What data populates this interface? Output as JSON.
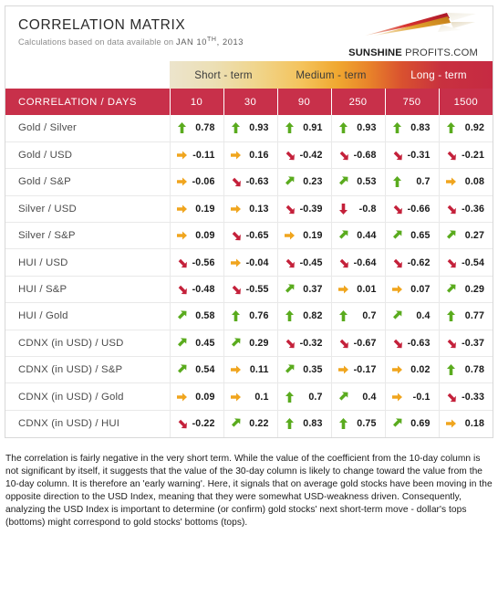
{
  "header": {
    "title": "CORRELATION MATRIX",
    "subtitle_prefix": "Calculations based on data available on",
    "date_day": "JAN 10",
    "date_ordinal": "TH",
    "date_year": ", 2013",
    "logo_bold": "SUNSHINE",
    "logo_rest": " PROFITS.COM"
  },
  "band": {
    "segments": [
      {
        "label": "Short - term",
        "span": 2
      },
      {
        "label": "Medium - term",
        "span": 2
      },
      {
        "label": "Long - term",
        "span": 2
      }
    ]
  },
  "table": {
    "corner_header": "CORRELATION / DAYS",
    "columns": [
      "10",
      "30",
      "90",
      "250",
      "750",
      "1500"
    ],
    "rows": [
      {
        "label": "Gold / Silver",
        "cells": [
          {
            "v": "0.78",
            "a": "arrow-up-green"
          },
          {
            "v": "0.93",
            "a": "arrow-up-green"
          },
          {
            "v": "0.91",
            "a": "arrow-up-green"
          },
          {
            "v": "0.93",
            "a": "arrow-up-green"
          },
          {
            "v": "0.83",
            "a": "arrow-up-green"
          },
          {
            "v": "0.92",
            "a": "arrow-up-green"
          }
        ]
      },
      {
        "label": "Gold / USD",
        "cells": [
          {
            "v": "-0.11",
            "a": "arrow-right-orange"
          },
          {
            "v": "0.16",
            "a": "arrow-right-orange"
          },
          {
            "v": "-0.42",
            "a": "arrow-downright-red"
          },
          {
            "v": "-0.68",
            "a": "arrow-downright-red"
          },
          {
            "v": "-0.31",
            "a": "arrow-downright-red"
          },
          {
            "v": "-0.21",
            "a": "arrow-downright-red"
          }
        ]
      },
      {
        "label": "Gold / S&P",
        "cells": [
          {
            "v": "-0.06",
            "a": "arrow-right-orange"
          },
          {
            "v": "-0.63",
            "a": "arrow-downright-red"
          },
          {
            "v": "0.23",
            "a": "arrow-upright-green"
          },
          {
            "v": "0.53",
            "a": "arrow-upright-green"
          },
          {
            "v": "0.7",
            "a": "arrow-up-green"
          },
          {
            "v": "0.08",
            "a": "arrow-right-orange"
          }
        ]
      },
      {
        "label": "Silver / USD",
        "cells": [
          {
            "v": "0.19",
            "a": "arrow-right-orange"
          },
          {
            "v": "0.13",
            "a": "arrow-right-orange"
          },
          {
            "v": "-0.39",
            "a": "arrow-downright-red"
          },
          {
            "v": "-0.8",
            "a": "arrow-down-red"
          },
          {
            "v": "-0.66",
            "a": "arrow-downright-red"
          },
          {
            "v": "-0.36",
            "a": "arrow-downright-red"
          }
        ]
      },
      {
        "label": "Silver / S&P",
        "cells": [
          {
            "v": "0.09",
            "a": "arrow-right-orange"
          },
          {
            "v": "-0.65",
            "a": "arrow-downright-red"
          },
          {
            "v": "0.19",
            "a": "arrow-right-orange"
          },
          {
            "v": "0.44",
            "a": "arrow-upright-green"
          },
          {
            "v": "0.65",
            "a": "arrow-upright-green"
          },
          {
            "v": "0.27",
            "a": "arrow-upright-green"
          }
        ]
      },
      {
        "label": "HUI / USD",
        "cells": [
          {
            "v": "-0.56",
            "a": "arrow-downright-red"
          },
          {
            "v": "-0.04",
            "a": "arrow-right-orange"
          },
          {
            "v": "-0.45",
            "a": "arrow-downright-red"
          },
          {
            "v": "-0.64",
            "a": "arrow-downright-red"
          },
          {
            "v": "-0.62",
            "a": "arrow-downright-red"
          },
          {
            "v": "-0.54",
            "a": "arrow-downright-red"
          }
        ]
      },
      {
        "label": "HUI / S&P",
        "cells": [
          {
            "v": "-0.48",
            "a": "arrow-downright-red"
          },
          {
            "v": "-0.55",
            "a": "arrow-downright-red"
          },
          {
            "v": "0.37",
            "a": "arrow-upright-green"
          },
          {
            "v": "0.01",
            "a": "arrow-right-orange"
          },
          {
            "v": "0.07",
            "a": "arrow-right-orange"
          },
          {
            "v": "0.29",
            "a": "arrow-upright-green"
          }
        ]
      },
      {
        "label": "HUI / Gold",
        "cells": [
          {
            "v": "0.58",
            "a": "arrow-upright-green"
          },
          {
            "v": "0.76",
            "a": "arrow-up-green"
          },
          {
            "v": "0.82",
            "a": "arrow-up-green"
          },
          {
            "v": "0.7",
            "a": "arrow-up-green"
          },
          {
            "v": "0.4",
            "a": "arrow-upright-green"
          },
          {
            "v": "0.77",
            "a": "arrow-up-green"
          }
        ]
      },
      {
        "label": "CDNX (in USD) / USD",
        "cells": [
          {
            "v": "0.45",
            "a": "arrow-upright-green"
          },
          {
            "v": "0.29",
            "a": "arrow-upright-green"
          },
          {
            "v": "-0.32",
            "a": "arrow-downright-red"
          },
          {
            "v": "-0.67",
            "a": "arrow-downright-red"
          },
          {
            "v": "-0.63",
            "a": "arrow-downright-red"
          },
          {
            "v": "-0.37",
            "a": "arrow-downright-red"
          }
        ]
      },
      {
        "label": "CDNX (in USD) / S&P",
        "cells": [
          {
            "v": "0.54",
            "a": "arrow-upright-green"
          },
          {
            "v": "0.11",
            "a": "arrow-right-orange"
          },
          {
            "v": "0.35",
            "a": "arrow-upright-green"
          },
          {
            "v": "-0.17",
            "a": "arrow-right-orange"
          },
          {
            "v": "0.02",
            "a": "arrow-right-orange"
          },
          {
            "v": "0.78",
            "a": "arrow-up-green"
          }
        ]
      },
      {
        "label": "CDNX (in USD) / Gold",
        "cells": [
          {
            "v": "0.09",
            "a": "arrow-right-orange"
          },
          {
            "v": "0.1",
            "a": "arrow-right-orange"
          },
          {
            "v": "0.7",
            "a": "arrow-up-green"
          },
          {
            "v": "0.4",
            "a": "arrow-upright-green"
          },
          {
            "v": "-0.1",
            "a": "arrow-right-orange"
          },
          {
            "v": "-0.33",
            "a": "arrow-downright-red"
          }
        ]
      },
      {
        "label": "CDNX (in USD) / HUI",
        "cells": [
          {
            "v": "-0.22",
            "a": "arrow-downright-red"
          },
          {
            "v": "0.22",
            "a": "arrow-upright-green"
          },
          {
            "v": "0.83",
            "a": "arrow-up-green"
          },
          {
            "v": "0.75",
            "a": "arrow-up-green"
          },
          {
            "v": "0.69",
            "a": "arrow-upright-green"
          },
          {
            "v": "0.18",
            "a": "arrow-right-orange"
          }
        ]
      }
    ]
  },
  "commentary": "The correlation is fairly negative in the very short term. While the value of the coefficient from the 10-day column is not significant by itself, it suggests that the value of the 30-day column is likely to change toward the value from the 10-day column. It is therefore an 'early warning'. Here, it signals that on average gold stocks have been moving in the opposite direction to the USD Index, meaning that they were somewhat USD-weakness driven. Consequently, analyzing the USD Index is important to determine (or confirm) gold stocks' next short-term move - dollar's tops (bottoms) might correspond to gold stocks' bottoms (tops).",
  "colors": {
    "header_red": "#c8304a",
    "green": "#5aab1e",
    "orange": "#f0a51e",
    "red": "#c4203a",
    "band_start": "#ece4cc",
    "band_mid": "#f0a830",
    "band_end": "#c62a42"
  }
}
